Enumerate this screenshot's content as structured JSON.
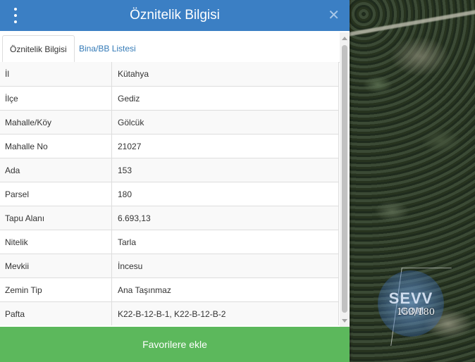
{
  "header": {
    "title": "Öznitelik Bilgisi",
    "close_glyph": "✕"
  },
  "tabs": [
    {
      "label": "Öznitelik Bilgisi",
      "active": true
    },
    {
      "label": "Bina/BB Listesi",
      "active": false
    }
  ],
  "attributes": [
    {
      "key": "İl",
      "value": "Kütahya"
    },
    {
      "key": "İlçe",
      "value": "Gediz"
    },
    {
      "key": "Mahalle/Köy",
      "value": "Gölcük"
    },
    {
      "key": "Mahalle No",
      "value": "21027"
    },
    {
      "key": "Ada",
      "value": "153"
    },
    {
      "key": "Parsel",
      "value": "180"
    },
    {
      "key": "Tapu Alanı",
      "value": "6.693,13"
    },
    {
      "key": "Nitelik",
      "value": "Tarla"
    },
    {
      "key": "Mevkii",
      "value": "İncesu"
    },
    {
      "key": "Zemin Tip",
      "value": "Ana Taşınmaz"
    },
    {
      "key": "Pafta",
      "value": "K22-B-12-B-1, K22-B-12-B-2"
    }
  ],
  "footer": {
    "favorite_label": "Favorilere ekle"
  },
  "map": {
    "parcel_label": "153/180",
    "watermark_line1": "SEVV",
    "watermark_line2": ".COM"
  },
  "colors": {
    "header": "#3b7fc4",
    "favorite_button": "#5cb85c",
    "link": "#337ab7"
  }
}
